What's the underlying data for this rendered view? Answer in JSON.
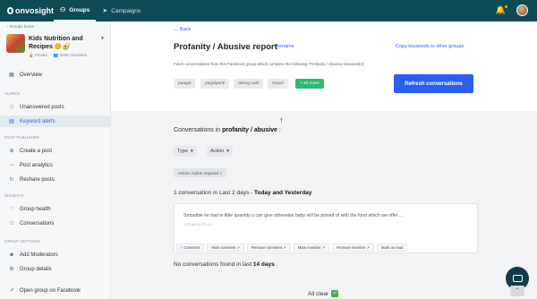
{
  "topbar": {
    "logo": "onvosight",
    "tabs": [
      {
        "label": "Groups",
        "icon": "people-icon",
        "active": true
      },
      {
        "label": "Campaigns",
        "icon": "send-icon",
        "active": false
      }
    ]
  },
  "sidebar": {
    "back_label": "Groups home",
    "group": {
      "name": "Kids Nutrition and Recipes 😊🥑",
      "privacy": "Private",
      "members": "340K members"
    },
    "overview": "Overview",
    "section_alerts": "ALERTS",
    "unanswered": "Unanswered posts",
    "keyword_alerts": "Keyword alerts",
    "section_post_publisher": "POST PUBLISHER",
    "create_post": "Create a post",
    "post_analytics": "Post analytics",
    "reshare_posts": "Reshare posts",
    "section_insights": "INSIGHTS",
    "group_health": "Group health",
    "conversations": "Conversations",
    "section_group_settings": "GROUP SETTINGS",
    "add_moderators": "Add Moderators",
    "group_details": "Group details",
    "open_group": "Open group on Facebook"
  },
  "main": {
    "back": "← Back",
    "title": "Profanity / Abusive report",
    "rename": "Rename",
    "copy_keywords": "Copy keywords to other groups",
    "description": "Fetch conversations from this Facebook group which contains the following 'Profanity / Abusive keyword(s)'.",
    "keywords": [
      "paagal",
      "pagalpanti",
      "dekeg nahi",
      "stupid"
    ],
    "more_badge": "+ 42 more",
    "refresh_button": "Refresh conversations",
    "conv_heading_prefix": "Conversations in",
    "conv_heading_bold": "profanity / abusive",
    "conv_heading_suffix": ":",
    "filter_type": "Type",
    "filter_action": "Action",
    "chip": "Action: Action required ×",
    "period_prefix": "1 conversation in Last 2 days -",
    "period_bold": "Today and Yesterday",
    "post_text": "Smoothie ke bad in little quantity u can give otherwise baby will be pissed of with the food which we offer ...",
    "post_time": "1:02 AM (CST) 12",
    "actions": [
      "Comment",
      "Hide comment",
      "Remove comment",
      "Mute member",
      "Remove member",
      "Mark as read"
    ],
    "none_prefix": "No conversations found in last",
    "none_bold": "14 days",
    "all_clear": "All clear",
    "all_clear_check": "✓"
  }
}
